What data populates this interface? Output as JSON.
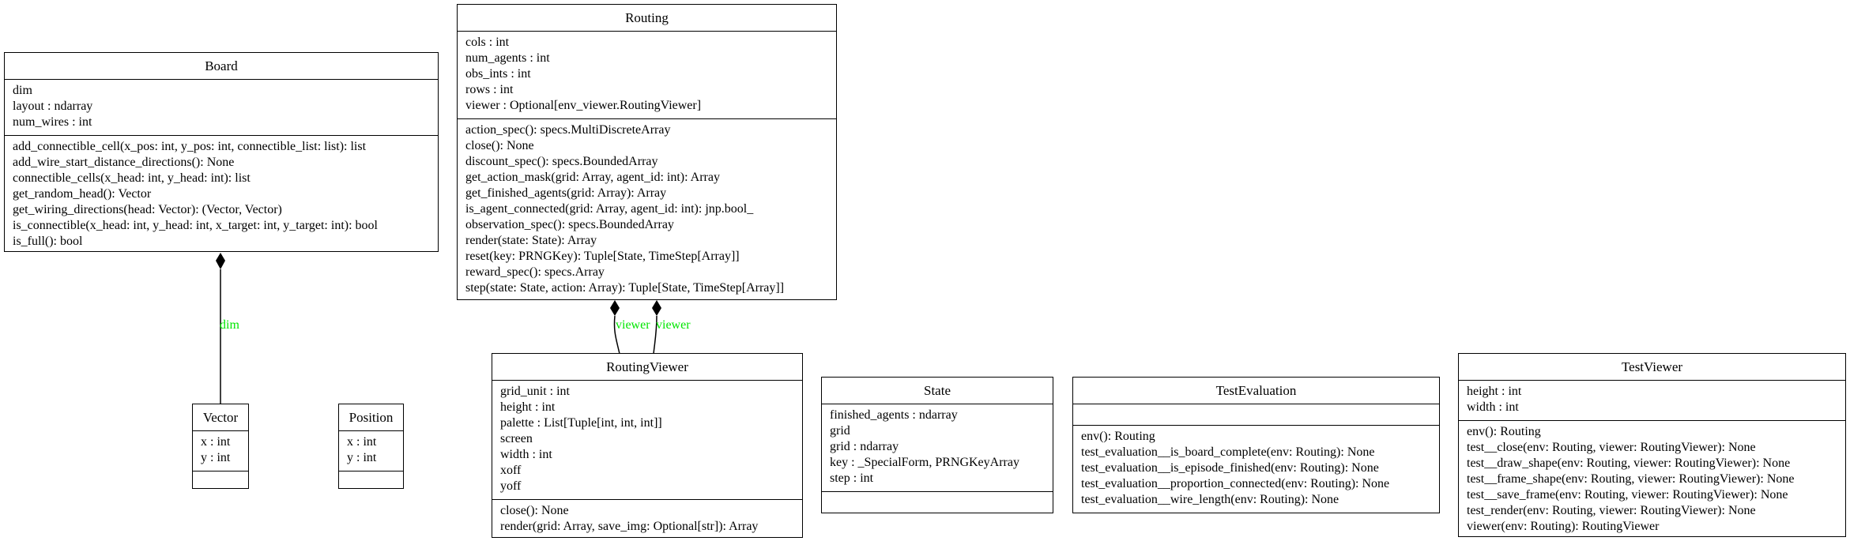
{
  "classes": [
    {
      "id": "Board",
      "title": "Board",
      "attributes": [
        "dim",
        "layout : ndarray",
        "num_wires : int"
      ],
      "methods": [
        "add_connectible_cell(x_pos: int, y_pos: int, connectible_list: list): list",
        "add_wire_start_distance_directions(): None",
        "connectible_cells(x_head: int, y_head: int): list",
        "get_random_head(): Vector",
        "get_wiring_directions(head: Vector): (Vector, Vector)",
        "is_connectible(x_head: int, y_head: int, x_target: int, y_target: int): bool",
        "is_full(): bool"
      ]
    },
    {
      "id": "Routing",
      "title": "Routing",
      "attributes": [
        "cols : int",
        "num_agents : int",
        "obs_ints : int",
        "rows : int",
        "viewer : Optional[env_viewer.RoutingViewer]"
      ],
      "methods": [
        "action_spec(): specs.MultiDiscreteArray",
        "close(): None",
        "discount_spec(): specs.BoundedArray",
        "get_action_mask(grid: Array, agent_id: int): Array",
        "get_finished_agents(grid: Array): Array",
        "is_agent_connected(grid: Array, agent_id: int): jnp.bool_",
        "observation_spec(): specs.BoundedArray",
        "render(state: State): Array",
        "reset(key: PRNGKey): Tuple[State, TimeStep[Array]]",
        "reward_spec(): specs.Array",
        "step(state: State, action: Array): Tuple[State, TimeStep[Array]]"
      ]
    },
    {
      "id": "Vector",
      "title": "Vector",
      "attributes": [
        "x : int",
        "y : int"
      ],
      "methods": []
    },
    {
      "id": "Position",
      "title": "Position",
      "attributes": [
        "x : int",
        "y : int"
      ],
      "methods": []
    },
    {
      "id": "RoutingViewer",
      "title": "RoutingViewer",
      "attributes": [
        "grid_unit : int",
        "height : int",
        "palette : List[Tuple[int, int, int]]",
        "screen",
        "width : int",
        "xoff",
        "yoff"
      ],
      "methods": [
        "close(): None",
        "render(grid: Array, save_img: Optional[str]): Array"
      ]
    },
    {
      "id": "State",
      "title": "State",
      "attributes": [
        "finished_agents : ndarray",
        "grid",
        "grid : ndarray",
        "key : _SpecialForm, PRNGKeyArray",
        "step : int"
      ],
      "methods": []
    },
    {
      "id": "TestEvaluation",
      "title": "TestEvaluation",
      "attributes": [],
      "methods": [
        "env(): Routing",
        "test_evaluation__is_board_complete(env: Routing): None",
        "test_evaluation__is_episode_finished(env: Routing): None",
        "test_evaluation__proportion_connected(env: Routing): None",
        "test_evaluation__wire_length(env: Routing): None"
      ]
    },
    {
      "id": "TestViewer",
      "title": "TestViewer",
      "attributes": [
        "height : int",
        "width : int"
      ],
      "methods": [
        "env(): Routing",
        "test__close(env: Routing, viewer: RoutingViewer): None",
        "test__draw_shape(env: Routing, viewer: RoutingViewer): None",
        "test__frame_shape(env: Routing, viewer: RoutingViewer): None",
        "test__save_frame(env: Routing, viewer: RoutingViewer): None",
        "test_render(env: Routing, viewer: RoutingViewer): None",
        "viewer(env: Routing): RoutingViewer"
      ]
    }
  ],
  "edges": [
    {
      "from": "Vector",
      "to": "Board",
      "kind": "composition",
      "label": "dim"
    },
    {
      "from": "RoutingViewer",
      "to": "Routing",
      "kind": "composition",
      "label": "viewer"
    },
    {
      "from": "RoutingViewer",
      "to": "Routing",
      "kind": "composition",
      "label": "viewer"
    }
  ],
  "colors": {
    "edge_label": "#00e600",
    "line": "#000000"
  }
}
